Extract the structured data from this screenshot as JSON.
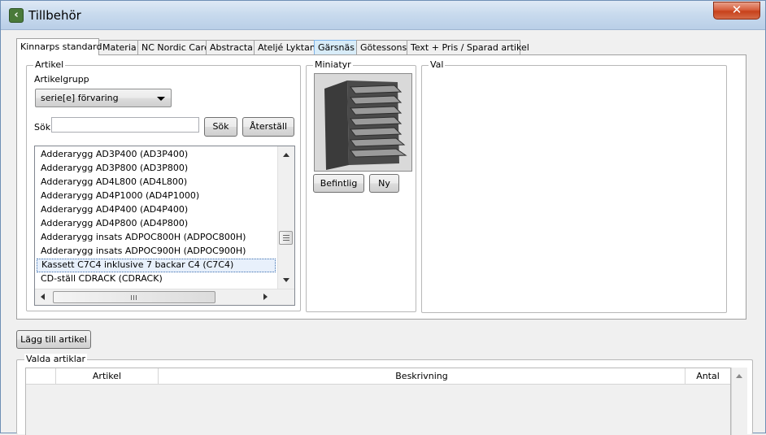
{
  "window": {
    "title": "Tillbehör",
    "close_glyph": "✕"
  },
  "tabs": [
    {
      "label": "Kinnarps standard"
    },
    {
      "label": "Materia"
    },
    {
      "label": "NC Nordic Care"
    },
    {
      "label": "Abstracta"
    },
    {
      "label": "Ateljé Lyktan"
    },
    {
      "label": "Gärsnäs"
    },
    {
      "label": "Götessons"
    },
    {
      "label": "Text + Pris / Sparad artikel"
    }
  ],
  "artikel": {
    "group_title": "Artikel",
    "artikelgrupp_label": "Artikelgrupp",
    "artikelgrupp_value": "serie[e] förvaring",
    "sok_label": "Sök",
    "search_value": "",
    "sok_button": "Sök",
    "reset_button": "Återställ",
    "items": [
      "Adderarygg AD3P400 (AD3P400)",
      "Adderarygg AD3P800 (AD3P800)",
      "Adderarygg AD4L800 (AD4L800)",
      "Adderarygg AD4P1000 (AD4P1000)",
      "Adderarygg AD4P400 (AD4P400)",
      "Adderarygg AD4P800 (AD4P800)",
      "Adderarygg insats ADPOC800H (ADPOC800H)",
      "Adderarygg insats ADPOC900H (ADPOC900H)",
      "Kassett C7C4 inklusive 7 backar C4 (C7C4)",
      "CD-ställ CDRACK (CDRACK)"
    ],
    "selected_index": 8
  },
  "miniatyr": {
    "group_title": "Miniatyr",
    "befintlig_button": "Befintlig",
    "ny_button": "Ny"
  },
  "val": {
    "group_title": "Val"
  },
  "lagg_till_button": "Lägg till artikel",
  "valda_artiklar": {
    "group_title": "Valda artiklar",
    "columns": [
      "",
      "Artikel",
      "Beskrivning",
      "Antal"
    ]
  },
  "colors": {
    "title_gradient_top": "#dfe9f5",
    "close_red": "#c7411b",
    "selection_border": "#3a6fb0",
    "tab_highlight": "#d8ecf8"
  }
}
